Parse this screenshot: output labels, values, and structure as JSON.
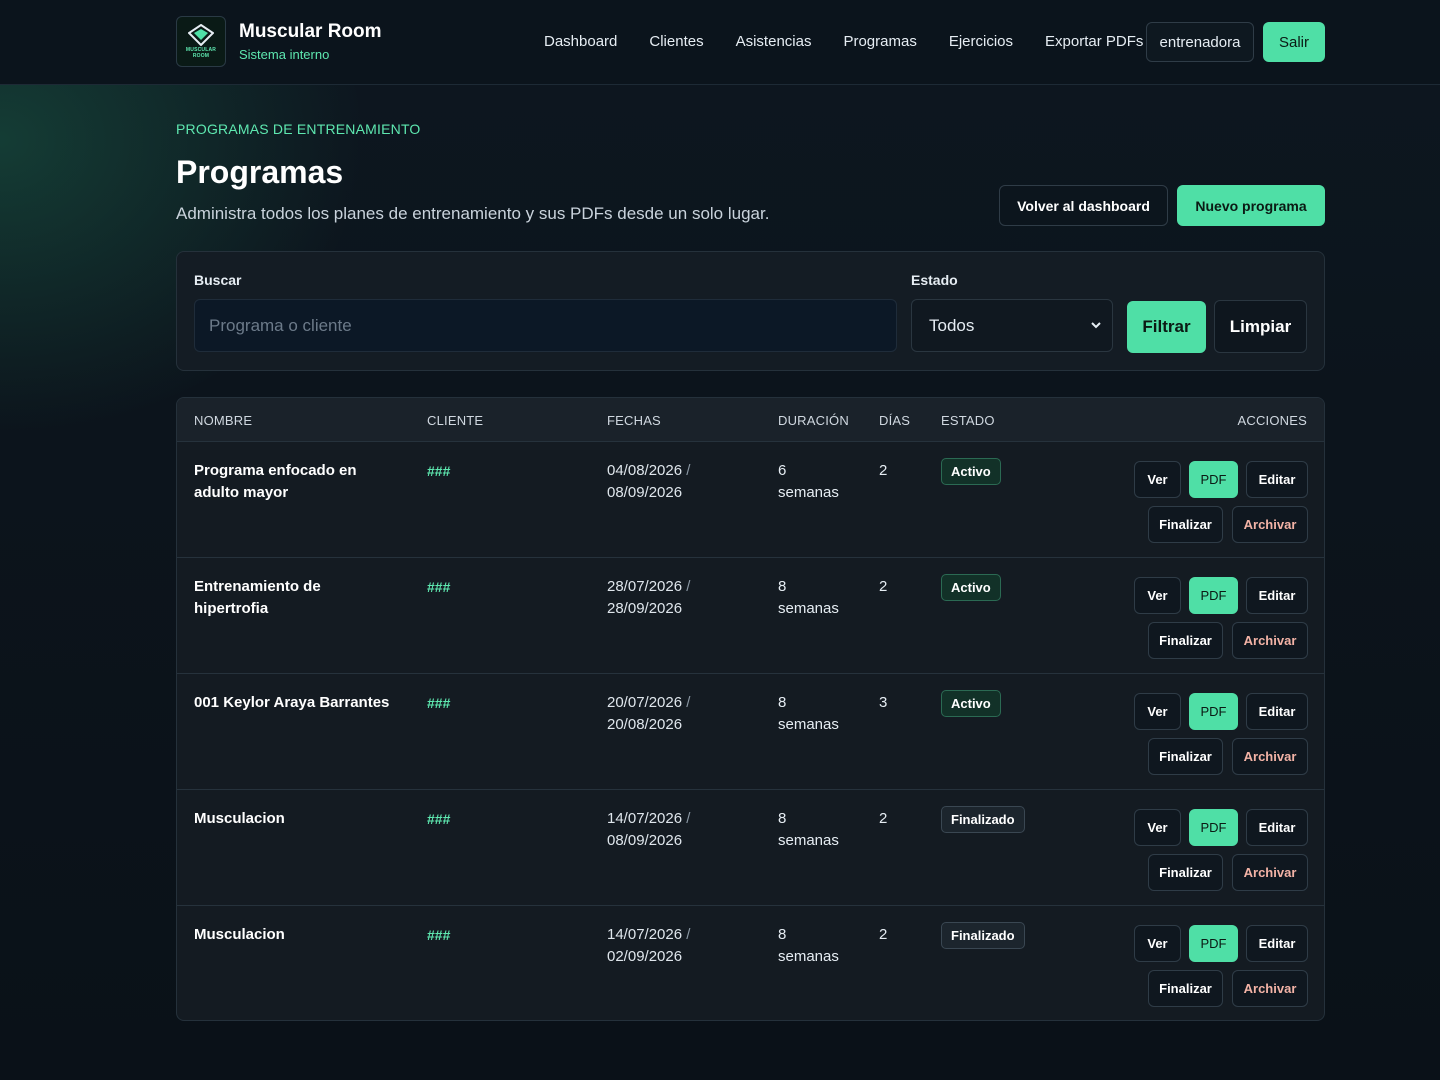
{
  "brand": {
    "name": "Muscular Room",
    "subtitle": "Sistema interno",
    "logo_text_line1": "MUSCULAR",
    "logo_text_line2": "ROOM"
  },
  "nav": {
    "links": [
      "Dashboard",
      "Clientes",
      "Asistencias",
      "Programas",
      "Ejercicios",
      "Exportar PDFs"
    ],
    "user": "entrenadora",
    "logout": "Salir"
  },
  "header": {
    "eyebrow": "PROGRAMAS DE ENTRENAMIENTO",
    "title": "Programas",
    "description": "Administra todos los planes de entrenamiento y sus PDFs desde un solo lugar.",
    "back_button": "Volver al dashboard",
    "new_button": "Nuevo programa"
  },
  "filters": {
    "search_label": "Buscar",
    "search_placeholder": "Programa o cliente",
    "search_value": "",
    "status_label": "Estado",
    "status_selected": "Todos",
    "filter_button": "Filtrar",
    "clear_button": "Limpiar"
  },
  "table": {
    "headers": {
      "name": "NOMBRE",
      "client": "CLIENTE",
      "dates": "FECHAS",
      "duration": "DURACIÓN",
      "days": "DÍAS",
      "status": "ESTADO",
      "actions": "ACCIONES"
    },
    "actions": {
      "view": "Ver",
      "pdf": "PDF",
      "edit": "Editar",
      "finish": "Finalizar",
      "archive": "Archivar"
    },
    "rows": [
      {
        "name": "Programa enfocado en adulto mayor",
        "client": "###",
        "start": "04/08/2026",
        "end": "08/09/2026",
        "duration_num": "6",
        "duration_unit": "semanas",
        "days": "2",
        "status": "Activo"
      },
      {
        "name": "Entrenamiento de hipertrofia",
        "client": "###",
        "start": "28/07/2026",
        "end": "28/09/2026",
        "duration_num": "8",
        "duration_unit": "semanas",
        "days": "2",
        "status": "Activo"
      },
      {
        "name": "001 Keylor Araya Barrantes",
        "client": "###",
        "start": "20/07/2026",
        "end": "20/08/2026",
        "duration_num": "8",
        "duration_unit": "semanas",
        "days": "3",
        "status": "Activo"
      },
      {
        "name": "Musculacion",
        "client": "###",
        "start": "14/07/2026",
        "end": "08/09/2026",
        "duration_num": "8",
        "duration_unit": "semanas",
        "days": "2",
        "status": "Finalizado"
      },
      {
        "name": "Musculacion",
        "client": "###",
        "start": "14/07/2026",
        "end": "02/09/2026",
        "duration_num": "8",
        "duration_unit": "semanas",
        "days": "2",
        "status": "Finalizado"
      }
    ]
  },
  "colors": {
    "accent": "#4fdfa6",
    "background": "#0c141c",
    "panel": "#141c24"
  },
  "icons": {
    "logo": "diamond-logo-icon",
    "select_arrow": "chevron-down-icon"
  }
}
